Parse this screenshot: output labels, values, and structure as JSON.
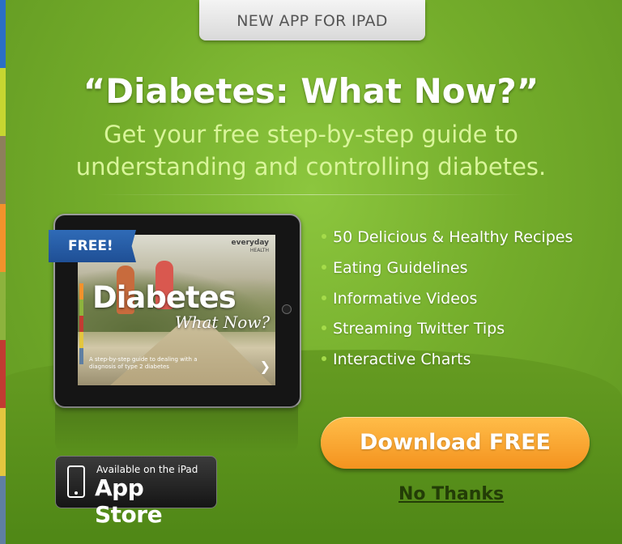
{
  "colors": {
    "background": "#74ad2b",
    "subhead": "#d9f59a",
    "button": "#f4931f",
    "ribbon": "#2f6bb7",
    "side_stripe": [
      "#2b6fc5",
      "#c6d631",
      "#8e7f5c",
      "#f2922c",
      "#8db33d",
      "#c23b32",
      "#e3c63f",
      "#5f7fa2"
    ]
  },
  "top_tab": {
    "label": "NEW APP FOR IPAD"
  },
  "headline": "“Diabetes: What Now?”",
  "subhead": "Get your free step-by-step guide to understanding and controlling diabetes.",
  "ipad": {
    "ribbon": "FREE!",
    "logo": "everyday",
    "logo_sub": "HEALTH",
    "title": "Diabetes",
    "subtitle": "What Now?",
    "caption": "A step-by-step guide to dealing with a diagnosis of type 2 diabetes",
    "arrow_icon": "chevron-right-icon"
  },
  "features": [
    "50 Delicious & Healthy Recipes",
    "Eating Guidelines",
    "Informative Videos",
    "Streaming Twitter Tips",
    "Interactive Charts"
  ],
  "download_button": "Download FREE",
  "no_thanks": "No Thanks",
  "app_store": {
    "line1": "Available on the iPad",
    "line2": "App Store",
    "icon": "ipad-icon"
  }
}
